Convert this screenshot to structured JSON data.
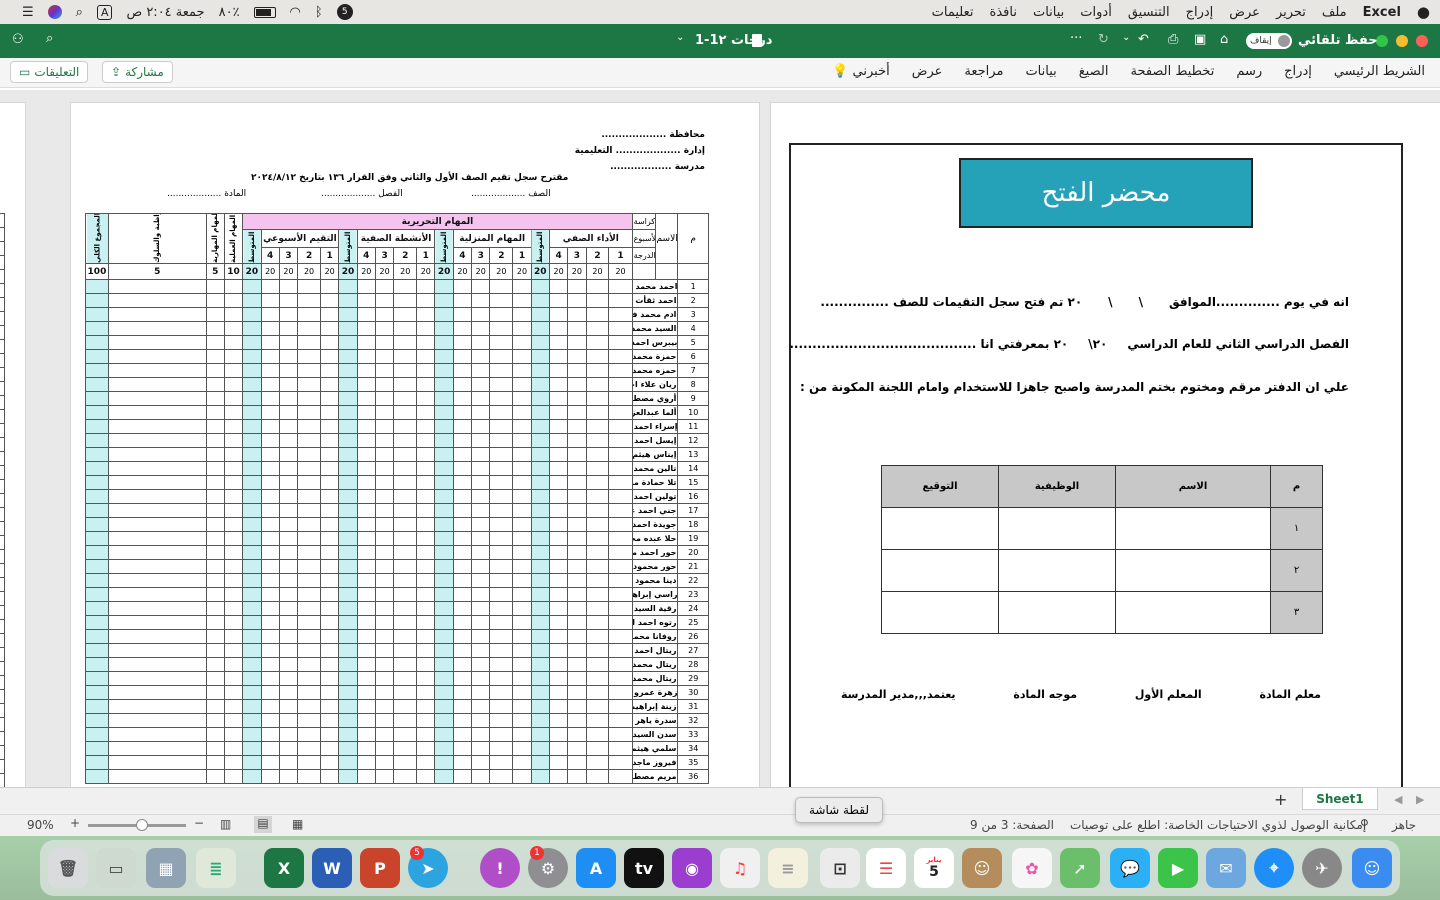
{
  "menubar": {
    "app": "Excel",
    "items": [
      "ملف",
      "تحرير",
      "عرض",
      "إدراج",
      "التنسيق",
      "أدوات",
      "بيانات",
      "نافذة",
      "تعليمات"
    ],
    "clock": "جمعة ٢:٠٤ ص",
    "battery": "٨٠٪",
    "input_indicator": "A"
  },
  "titlebar": {
    "doc_title": "1-1درجات ٢",
    "autosave_label": "حفظ تلقائي",
    "autosave_state": "إيقاف"
  },
  "ribbon": {
    "tabs": [
      "الشريط الرئيسي",
      "إدراج",
      "رسم",
      "تخطيط الصفحة",
      "الصيغ",
      "بيانات",
      "مراجعة",
      "عرض",
      "أخبرني"
    ],
    "share": "مشاركة",
    "comments": "التعليقات"
  },
  "form": {
    "title": "محضر الفتح",
    "line1_a": "انه في يوم ..............الموافق",
    "line1_b": "\\",
    "line1_c": "\\",
    "line1_d": "٢٠ تم فتح سجل التقيمات للصف ...............",
    "line2_a": "الفصل الدراسي الثاني للعام الدراسي",
    "line2_b": "٢٠\\",
    "line2_c": "٢٠ بمعرفتي انا .........................................",
    "line3": "علي ان الدفتر مرقم ومختوم بختم المدرسة واصبح جاهزا للاستخدام وامام اللجنة المكونة من :",
    "table_headers": [
      "م",
      "الاسم",
      "الوظيفية",
      "التوقيع"
    ],
    "table_rows": [
      "١",
      "٢",
      "٣"
    ],
    "signatures": [
      "معلم المادة",
      "المعلم الأول",
      "موجه المادة",
      "يعتمد,,,مدير المدرسة"
    ]
  },
  "grades": {
    "header": [
      "محافظة ...................",
      "إدارة ................... التعليمية",
      "مدرسة .................."
    ],
    "subtitle": "مقترح سجل تقيم الصف الأول والثاني وفق القرار ١٣٦ بتاريخ ٢٠٢٤/٨/١٢",
    "class_line": "الصف ...................",
    "section_line": "الفصل ...................",
    "subject_line": "المادة ...................",
    "col_m": "م",
    "col_name": "الاسم",
    "kurasa": "كراسة",
    "week": "الأسبوع",
    "grade": "الدرجة",
    "written": "المهام التحريرية",
    "in_class": "الأداء الصفي",
    "homework": "المهام المنزلية",
    "activities": "الأنشطة الصفية",
    "weekly": "التقيم الأسبوعي",
    "avg": "المتوسط",
    "col_perf": "المهام المهارية",
    "col_behavior": "المواظبة والسلوك",
    "col_practical": "المهام العملية",
    "col_total": "المجموع الكلي",
    "weeks": [
      "1",
      "2",
      "3",
      "4"
    ],
    "twenty": "20",
    "hundred": "100",
    "five": "5",
    "ten": "10",
    "students": [
      "احمد محمد شحته صالح",
      "احمد ثقأت سعيد",
      "ادم محمد فتحي",
      "السيد محمد فتحي",
      "بيبرس احمد محمد السيد",
      "حمزة محمد رمزي محمد",
      "حمزه محمد محمد جمال",
      "ريان علاء احمد",
      "أروي مصطفى إبراهيم",
      "ألما عبدالعزيز احمد",
      "إسراء احمد ايمن",
      "إيسل احمد السيد بخيت",
      "إيناس هيثم محمد",
      "تالين محمد علاء الدين",
      "تلا حمادة محمد إبراهيم",
      "تولين احمد فرج",
      "جني احمد عكاشة",
      "جويدة احمد شعبان",
      "حلا عبده محمد عبده",
      "حور احمد محمد السيد",
      "حور محمود عبدالعزيز",
      "دينا محمود السيد احمد",
      "راسي إبراهيم احمد",
      "رقية السيد علي",
      "رتوه احمد الحسيني",
      "روفانا محمد عبدالرحمن",
      "ريتال احمد محمد السيد",
      "ريتال محمد السيد عبدالحميد",
      "ريتال محمد سعيد حسن",
      "زهرة عمرو محمد",
      "زينة إبراهيم محمد",
      "سدرة ياهر محمود",
      "سدن السيد محمد",
      "سلمي هيثم احمد",
      "فيروز ماجد احمد",
      "مريم مصطفى ثروت"
    ]
  },
  "sheettab": "Sheet1",
  "status": {
    "ready": "جاهز",
    "accessibility": "إمكانية الوصول لذوي الاحتياجات الخاصة: اطلع على توصيات",
    "page": "الصفحة: 3 من 9",
    "zoom": "90%",
    "tooltip": "لقطة شاشة"
  },
  "dock_badges": {
    "telegram": "5",
    "settings": "1",
    "calendar_day": "5",
    "calendar_month": "يناير"
  }
}
